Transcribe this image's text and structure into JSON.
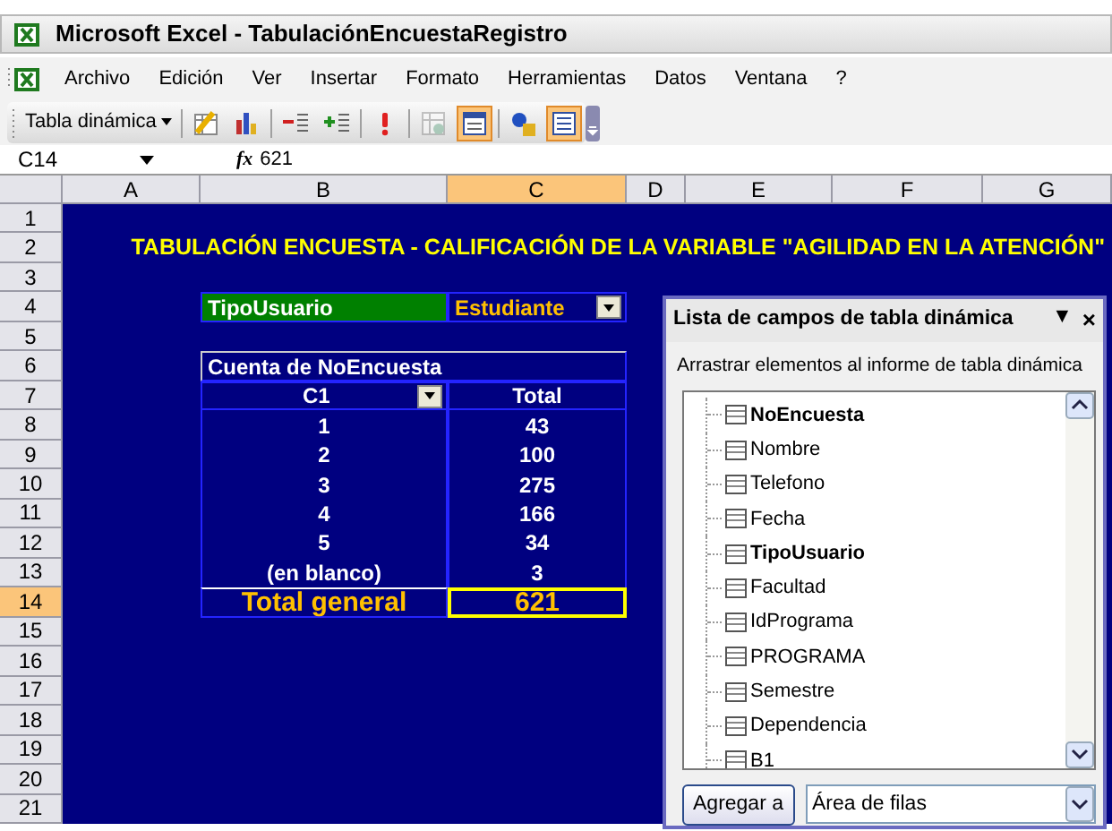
{
  "window": {
    "title": "Microsoft Excel - TabulaciónEncuestaRegistro"
  },
  "menu": [
    {
      "label": "Archivo"
    },
    {
      "label": "Edición"
    },
    {
      "label": "Ver"
    },
    {
      "label": "Insertar"
    },
    {
      "label": "Formato"
    },
    {
      "label": "Herramientas"
    },
    {
      "label": "Datos"
    },
    {
      "label": "Ventana"
    },
    {
      "label": "?"
    }
  ],
  "toolbar": [
    {
      "kind": "dropdown",
      "label": "Tabla dinámica"
    },
    {
      "kind": "separator"
    },
    {
      "kind": "button",
      "pressed": false,
      "disabled": false
    },
    {
      "kind": "button",
      "pressed": false,
      "disabled": false
    },
    {
      "kind": "separator"
    },
    {
      "kind": "button",
      "pressed": false,
      "disabled": false
    },
    {
      "kind": "button",
      "pressed": false,
      "disabled": false
    },
    {
      "kind": "separator"
    },
    {
      "kind": "button",
      "pressed": false,
      "disabled": false
    },
    {
      "kind": "separator"
    },
    {
      "kind": "button",
      "pressed": false,
      "disabled": true
    },
    {
      "kind": "button",
      "pressed": true,
      "disabled": false
    },
    {
      "kind": "separator"
    },
    {
      "kind": "button",
      "pressed": false,
      "disabled": false
    },
    {
      "kind": "button",
      "pressed": true,
      "disabled": false
    }
  ],
  "formula_bar": {
    "name_box": "C14",
    "function_label": "fx",
    "value": "621"
  },
  "columns": [
    {
      "label": "A",
      "selected": false
    },
    {
      "label": "B",
      "selected": false
    },
    {
      "label": "C",
      "selected": true
    },
    {
      "label": "D",
      "selected": false
    },
    {
      "label": "E",
      "selected": false
    },
    {
      "label": "F",
      "selected": false
    },
    {
      "label": "G",
      "selected": false
    }
  ],
  "rows": [
    {
      "label": "1",
      "selected": false
    },
    {
      "label": "2",
      "selected": false
    },
    {
      "label": "3",
      "selected": false
    },
    {
      "label": "4",
      "selected": false
    },
    {
      "label": "5",
      "selected": false
    },
    {
      "label": "6",
      "selected": false
    },
    {
      "label": "7",
      "selected": false
    },
    {
      "label": "8",
      "selected": false
    },
    {
      "label": "9",
      "selected": false
    },
    {
      "label": "10",
      "selected": false
    },
    {
      "label": "11",
      "selected": false
    },
    {
      "label": "12",
      "selected": false
    },
    {
      "label": "13",
      "selected": false
    },
    {
      "label": "14",
      "selected": true
    },
    {
      "label": "15",
      "selected": false
    },
    {
      "label": "16",
      "selected": false
    },
    {
      "label": "17",
      "selected": false
    },
    {
      "label": "18",
      "selected": false
    },
    {
      "label": "19",
      "selected": false
    },
    {
      "label": "20",
      "selected": false
    },
    {
      "label": "21",
      "selected": false
    }
  ],
  "sheet": {
    "title": "TABULACIÓN ENCUESTA - CALIFICACIÓN DE LA VARIABLE \"AGILIDAD EN LA ATENCIÓN\"",
    "pivot": {
      "page_field": {
        "label": "TipoUsuario",
        "value": "Estudiante"
      },
      "data_field": "Cuenta de NoEncuesta",
      "row_field": "C1",
      "value_header": "Total",
      "items": [
        {
          "label": "1",
          "value": "43"
        },
        {
          "label": "2",
          "value": "100"
        },
        {
          "label": "3",
          "value": "275"
        },
        {
          "label": "4",
          "value": "166"
        },
        {
          "label": "5",
          "value": "34"
        },
        {
          "label": "(en blanco)",
          "value": "3"
        }
      ],
      "grand_total": {
        "label": "Total general",
        "value": "621",
        "selected": true
      }
    }
  },
  "field_list": {
    "title": "Lista de campos de tabla dinámica",
    "menu_glyph": "▼",
    "close_glyph": "×",
    "instruction": "Arrastrar elementos al informe de tabla dinámica",
    "fields": [
      {
        "label": "NoEncuesta",
        "in_report": true
      },
      {
        "label": "Nombre",
        "in_report": false
      },
      {
        "label": "Telefono",
        "in_report": false
      },
      {
        "label": "Fecha",
        "in_report": false
      },
      {
        "label": "TipoUsuario",
        "in_report": true
      },
      {
        "label": "Facultad",
        "in_report": false
      },
      {
        "label": "IdPrograma",
        "in_report": false
      },
      {
        "label": "PROGRAMA",
        "in_report": false
      },
      {
        "label": "Semestre",
        "in_report": false
      },
      {
        "label": "Dependencia",
        "in_report": false
      },
      {
        "label": "B1",
        "in_report": false
      }
    ],
    "add_button": "Agregar a",
    "area": "Área de filas"
  }
}
